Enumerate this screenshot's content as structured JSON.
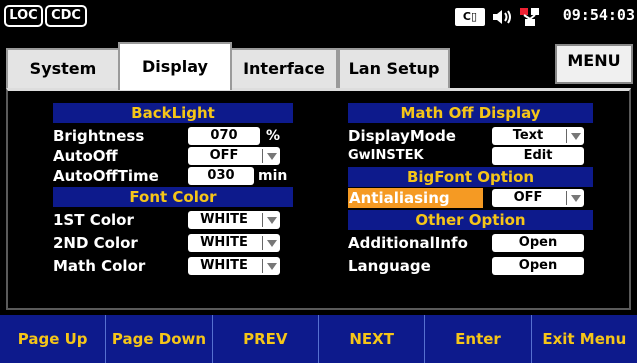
{
  "status": {
    "loc": "LOC",
    "cdc": "CDC",
    "clock": "09:54:03"
  },
  "tabs": [
    {
      "label": "System"
    },
    {
      "label": "Display"
    },
    {
      "label": "Interface"
    },
    {
      "label": "Lan Setup"
    }
  ],
  "menu_label": "MENU",
  "left": {
    "backlight_header": "BackLight",
    "brightness_label": "Brightness",
    "brightness_value": "070",
    "brightness_unit": "%",
    "autooff_label": "AutoOff",
    "autooff_value": "OFF",
    "autoofftime_label": "AutoOffTime",
    "autoofftime_value": "030",
    "autoofftime_unit": "min",
    "fontcolor_header": "Font Color",
    "color1_label": "1ST Color",
    "color1_value": "WHITE",
    "color2_label": "2ND Color",
    "color2_value": "WHITE",
    "mathcolor_label": "Math Color",
    "mathcolor_value": "WHITE"
  },
  "right": {
    "mathoff_header": "Math Off Display",
    "displaymode_label": "DisplayMode",
    "displaymode_value": "Text",
    "gwinstek_label": "GwINSTEK",
    "gwinstek_button": "Edit",
    "bigfont_header": "BigFont Option",
    "antialiasing_label": "Antialiasing",
    "antialiasing_value": "OFF",
    "other_header": "Other Option",
    "additionalinfo_label": "AdditionalInfo",
    "additionalinfo_button": "Open",
    "language_label": "Language",
    "language_button": "Open"
  },
  "softkeys": [
    {
      "label": "Page Up"
    },
    {
      "label": "Page Down"
    },
    {
      "label": "PREV"
    },
    {
      "label": "NEXT"
    },
    {
      "label": "Enter"
    },
    {
      "label": "Exit Menu"
    }
  ],
  "colors": {
    "header_bg": "#0d1a8c",
    "header_text": "#f5c518",
    "highlight": "#f59a23"
  }
}
